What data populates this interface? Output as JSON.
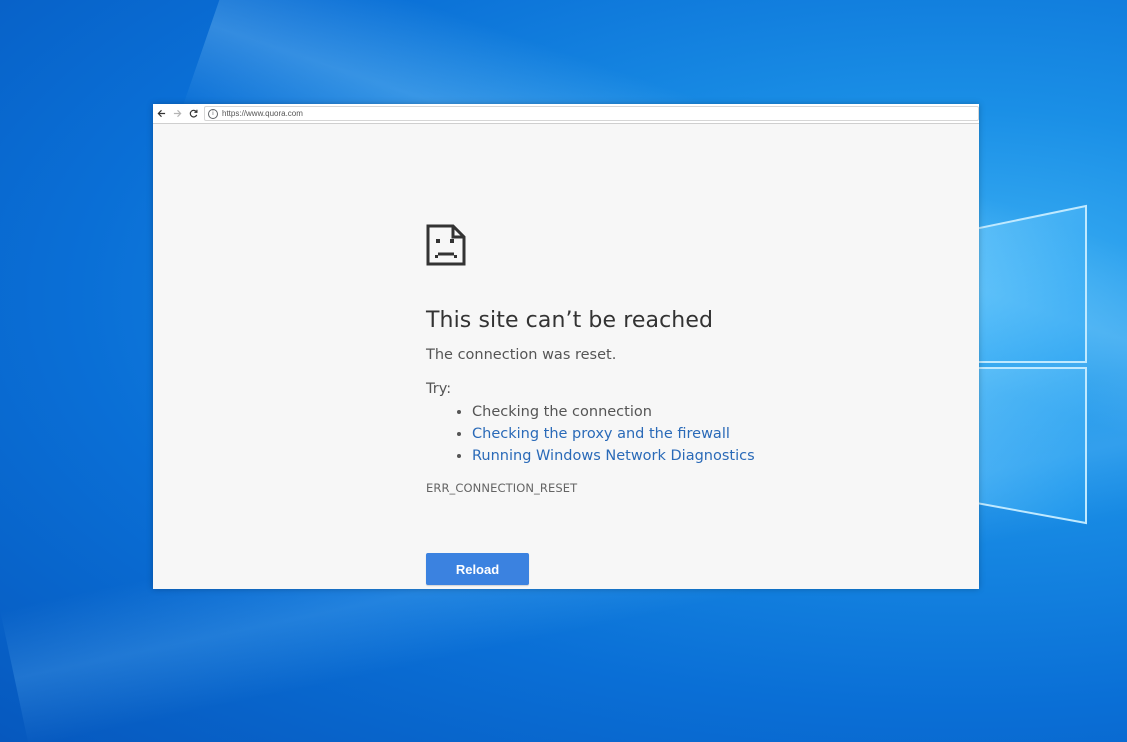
{
  "browser": {
    "url": "https://www.quora.com",
    "back_icon": "back-arrow-icon",
    "forward_icon": "forward-arrow-icon",
    "reload_icon": "reload-icon",
    "info_icon": "info-icon"
  },
  "error_page": {
    "icon": "sad-page-icon",
    "title": "This site can’t be reached",
    "subtitle": "The connection was reset.",
    "try_label": "Try:",
    "suggestions": [
      {
        "text": "Checking the connection",
        "link": false
      },
      {
        "text": "Checking the proxy and the firewall",
        "link": true
      },
      {
        "text": "Running Windows Network Diagnostics",
        "link": true
      }
    ],
    "error_code": "ERR_CONNECTION_RESET",
    "reload_label": "Reload"
  },
  "colors": {
    "desktop_blue": "#0a6fd6",
    "link_blue": "#2a6ab8",
    "button_blue": "#3b82e0",
    "page_bg": "#f7f7f7"
  }
}
